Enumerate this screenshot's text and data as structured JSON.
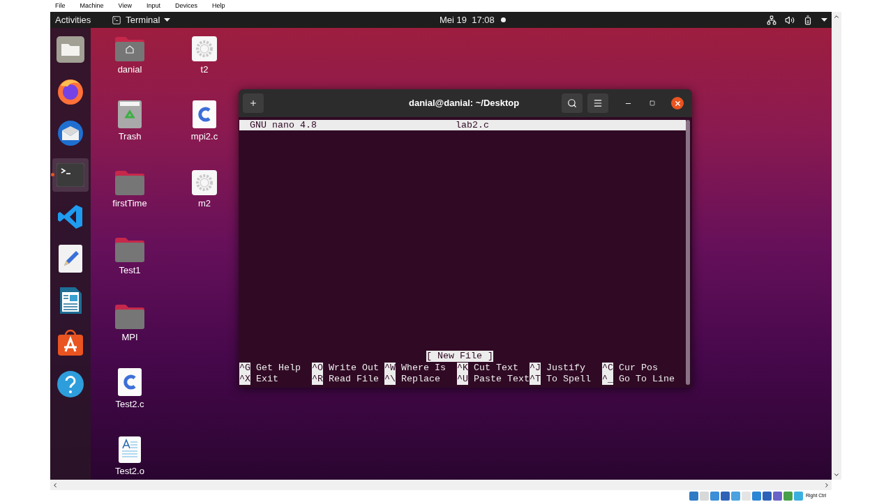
{
  "vm_menu": [
    "File",
    "Machine",
    "View",
    "Input",
    "Devices",
    "Help"
  ],
  "top_bar": {
    "activities": "Activities",
    "app_menu": "Terminal",
    "clock": "Mei 19  17:08"
  },
  "dock": [
    {
      "kind": "files",
      "selected": false
    },
    {
      "kind": "firefox",
      "selected": false
    },
    {
      "kind": "mail",
      "selected": false
    },
    {
      "kind": "terminal",
      "selected": true
    },
    {
      "kind": "code",
      "selected": false
    },
    {
      "kind": "editor",
      "selected": false
    },
    {
      "kind": "writer",
      "selected": false
    },
    {
      "kind": "store",
      "selected": false
    },
    {
      "kind": "help",
      "selected": false
    }
  ],
  "desktop_columns": [
    [
      {
        "label": "danial",
        "kind": "home"
      },
      {
        "label": "Trash",
        "kind": "trash"
      },
      {
        "label": "firstTime",
        "kind": "folder"
      },
      {
        "label": "Test1",
        "kind": "folder"
      },
      {
        "label": "MPI",
        "kind": "folder"
      },
      {
        "label": "Test2.c",
        "kind": "c"
      },
      {
        "label": "Test2.o",
        "kind": "doc"
      }
    ],
    [
      {
        "label": "t2",
        "kind": "exec"
      },
      {
        "label": "mpi2.c",
        "kind": "c"
      },
      {
        "label": "m2",
        "kind": "exec"
      }
    ]
  ],
  "terminal": {
    "title": "danial@danial: ~/Desktop",
    "nano": {
      "version": "GNU nano 4.8",
      "filename": "lab2.c",
      "status": "[ New File ]",
      "shortcut_rows": [
        [
          {
            "key": "^G",
            "label": "Get Help"
          },
          {
            "key": "^O",
            "label": "Write Out"
          },
          {
            "key": "^W",
            "label": "Where Is"
          },
          {
            "key": "^K",
            "label": "Cut Text"
          },
          {
            "key": "^J",
            "label": "Justify"
          },
          {
            "key": "^C",
            "label": "Cur Pos"
          }
        ],
        [
          {
            "key": "^X",
            "label": "Exit"
          },
          {
            "key": "^R",
            "label": "Read File"
          },
          {
            "key": "^\\",
            "label": "Replace"
          },
          {
            "key": "^U",
            "label": "Paste Text"
          },
          {
            "key": "^T",
            "label": "To Spell"
          },
          {
            "key": "^_",
            "label": "Go To Line"
          }
        ]
      ]
    }
  },
  "status_bar": {
    "host_key": "Right Ctrl"
  }
}
